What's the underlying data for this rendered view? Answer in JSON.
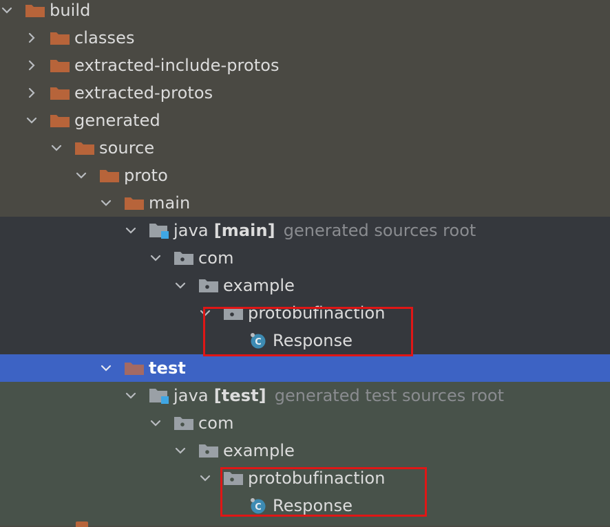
{
  "colors": {
    "folder": "#b7643a",
    "package_folder": "#9aa0a6",
    "root_badge": "#3fa6e4",
    "class_icon": "#3d8bb3",
    "selection": "#3d63c4",
    "highlight_box": "#e01616"
  },
  "tree": [
    {
      "label": "build",
      "expanded": true,
      "icon": "folder-icon"
    },
    {
      "label": "classes",
      "expanded": false,
      "icon": "folder-icon"
    },
    {
      "label": "extracted-include-protos",
      "expanded": false,
      "icon": "folder-icon"
    },
    {
      "label": "extracted-protos",
      "expanded": false,
      "icon": "folder-icon"
    },
    {
      "label": "generated",
      "expanded": true,
      "icon": "folder-icon"
    },
    {
      "label": "source",
      "expanded": true,
      "icon": "folder-icon"
    },
    {
      "label": "proto",
      "expanded": true,
      "icon": "folder-icon"
    },
    {
      "label": "main",
      "expanded": true,
      "icon": "folder-icon"
    },
    {
      "label": "java",
      "tag": "[main]",
      "hint": "generated sources root",
      "expanded": true,
      "icon": "source-root-icon"
    },
    {
      "label": "com",
      "expanded": true,
      "icon": "package-icon"
    },
    {
      "label": "example",
      "expanded": true,
      "icon": "package-icon"
    },
    {
      "label": "protobufinaction",
      "expanded": true,
      "icon": "package-icon"
    },
    {
      "label": "Response",
      "icon": "class-icon"
    },
    {
      "label": "test",
      "expanded": true,
      "icon": "folder-icon",
      "selected": true
    },
    {
      "label": "java",
      "tag": "[test]",
      "hint": "generated test sources root",
      "expanded": true,
      "icon": "source-root-icon"
    },
    {
      "label": "com",
      "expanded": true,
      "icon": "package-icon"
    },
    {
      "label": "example",
      "expanded": true,
      "icon": "package-icon"
    },
    {
      "label": "protobufinaction",
      "expanded": true,
      "icon": "package-icon"
    },
    {
      "label": "Response",
      "icon": "class-icon"
    }
  ]
}
